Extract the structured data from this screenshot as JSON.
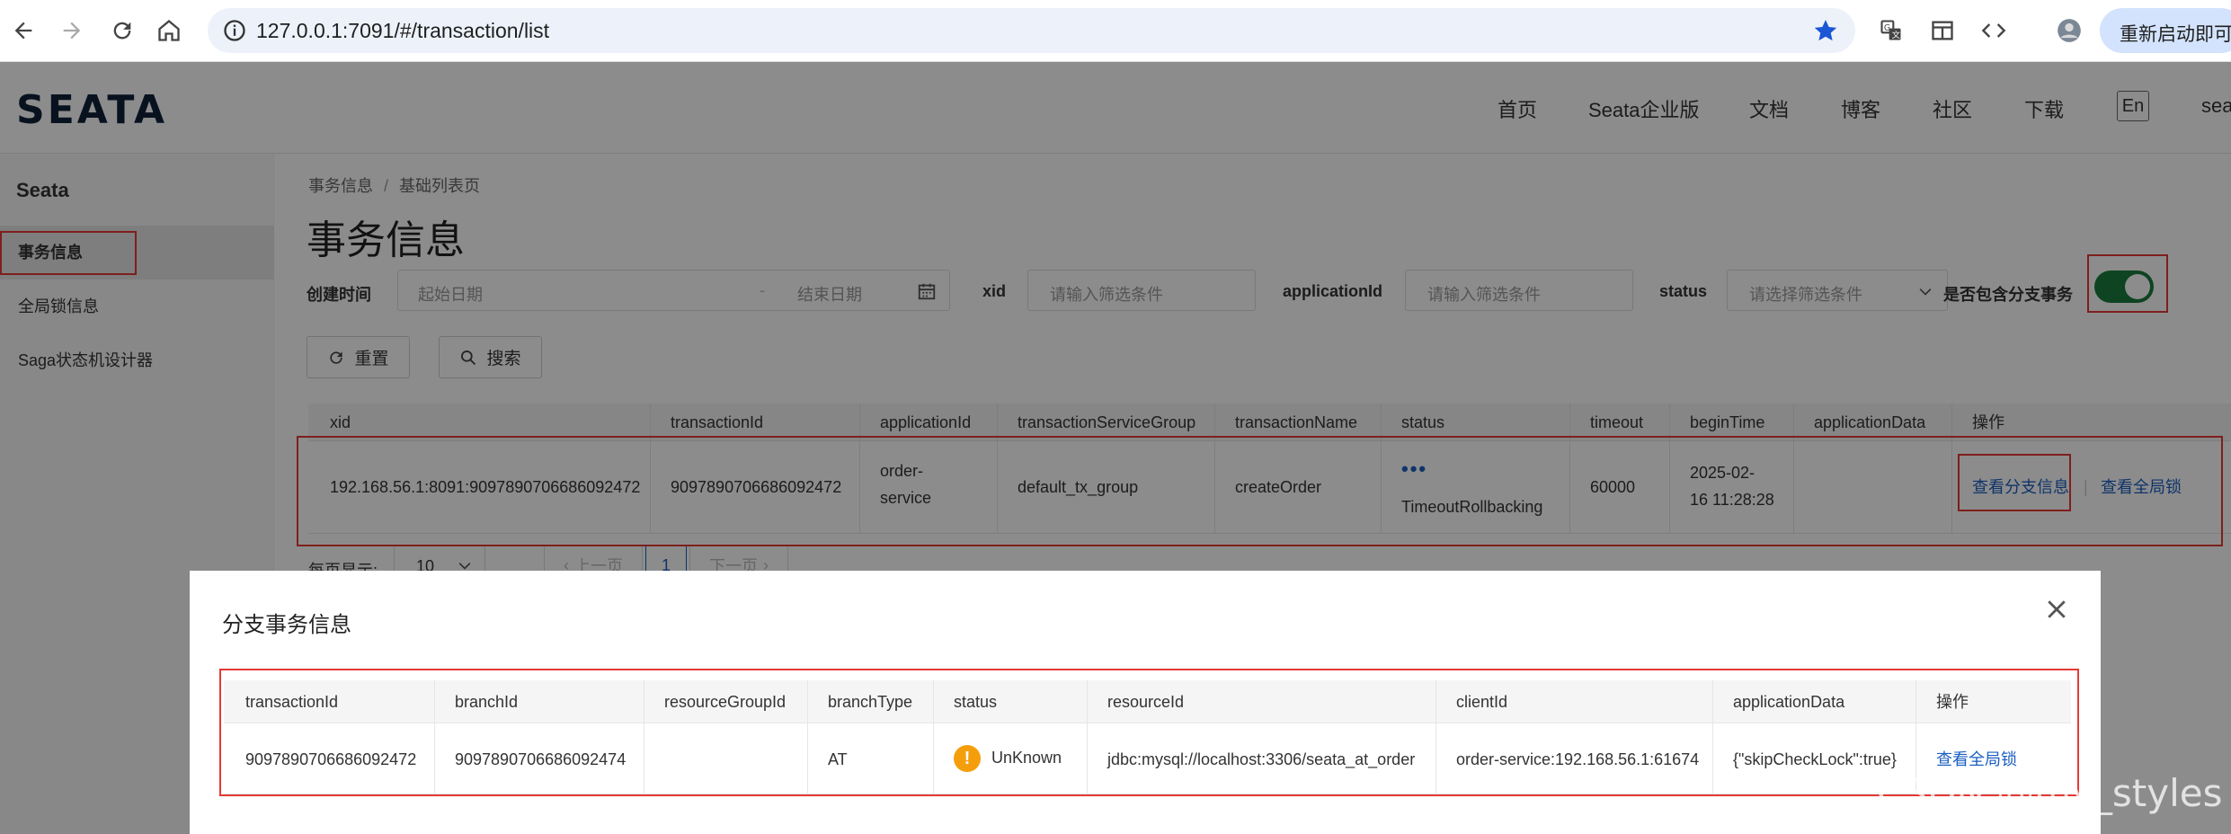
{
  "browser": {
    "url": "127.0.0.1:7091/#/transaction/list",
    "profile_button": "重新启动即可更"
  },
  "site": {
    "logo": "SEATA",
    "nav": [
      "首页",
      "Seata企业版",
      "文档",
      "博客",
      "社区",
      "下载"
    ],
    "lang": "En",
    "nav_extra": "seat"
  },
  "sidebar": {
    "title": "Seata",
    "items": [
      {
        "label": "事务信息",
        "active": true
      },
      {
        "label": "全局锁信息",
        "active": false
      },
      {
        "label": "Saga状态机设计器",
        "active": false
      }
    ]
  },
  "main": {
    "breadcrumb": [
      "事务信息",
      "基础列表页"
    ],
    "title": "事务信息",
    "filters": {
      "create_time_label": "创建时间",
      "start_placeholder": "起始日期",
      "date_sep": "-",
      "end_placeholder": "结束日期",
      "xid_label": "xid",
      "xid_placeholder": "请输入筛选条件",
      "appid_label": "applicationId",
      "appid_placeholder": "请输入筛选条件",
      "status_label": "status",
      "status_placeholder": "请选择筛选条件",
      "include_branch_label": "是否包含分支事务",
      "include_branch_on": true
    },
    "buttons": {
      "reset": "重置",
      "search": "搜索"
    },
    "table": {
      "headers": [
        "xid",
        "transactionId",
        "applicationId",
        "transactionServiceGroup",
        "transactionName",
        "status",
        "timeout",
        "beginTime",
        "applicationData",
        "操作"
      ],
      "rows": [
        {
          "xid": "192.168.56.1:8091:9097890706686092472",
          "transactionId": "9097890706686092472",
          "applicationId_line1": "order-",
          "applicationId_line2": "service",
          "transactionServiceGroup": "default_tx_group",
          "transactionName": "createOrder",
          "status_dots": "•••",
          "status": "TimeoutRollbacking",
          "timeout": "60000",
          "beginTime_line1": "2025-02-",
          "beginTime_line2": "16 11:28:28",
          "applicationData": "",
          "action_branch": "查看分支信息",
          "action_sep": "|",
          "action_lock": "查看全局锁"
        }
      ]
    },
    "pagination": {
      "per_page_label": "每页显示:",
      "per_page_value": "10",
      "prev": "上一页",
      "current": "1",
      "next": "下一页"
    }
  },
  "dialog": {
    "title": "分支事务信息",
    "close": "×",
    "headers": [
      "transactionId",
      "branchId",
      "resourceGroupId",
      "branchType",
      "status",
      "resourceId",
      "clientId",
      "applicationData",
      "操作"
    ],
    "rows": [
      {
        "transactionId": "9097890706686092472",
        "branchId": "9097890706686092474",
        "resourceGroupId": "",
        "branchType": "AT",
        "status_icon": "!",
        "status": "UnKnown",
        "resourceId": "jdbc:mysql://localhost:3306/seata_at_order",
        "clientId": "order-service:192.168.56.1:61674",
        "applicationData": "{\"skipCheckLock\":true}",
        "action": "查看全局锁"
      }
    ]
  },
  "watermark": "CSDN @my_styles",
  "colors": {
    "accent_link": "#1b5fc1",
    "toggle_on": "#1b7d3c",
    "annotation_red": "#e53935",
    "warning": "#f59e0b"
  }
}
